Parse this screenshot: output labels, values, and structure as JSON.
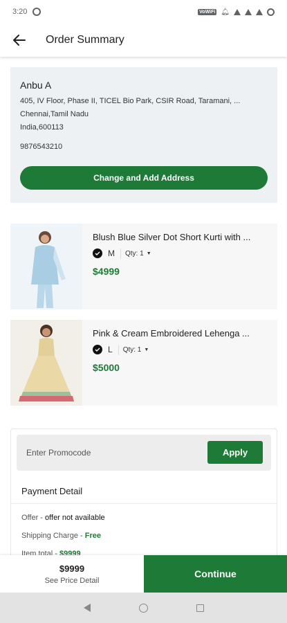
{
  "status_bar": {
    "time": "3:20",
    "vowifi": "VoWiFi"
  },
  "header": {
    "title": "Order Summary"
  },
  "address": {
    "name": "Anbu A",
    "line1": "405, IV Floor, Phase II, TICEL Bio Park, CSIR Road, Taramani, ...",
    "line2": "Chennai,Tamil Nadu",
    "line3": "India,600113",
    "phone": "9876543210",
    "button_label": "Change and Add Address"
  },
  "products": [
    {
      "title": "Blush Blue Silver Dot Short Kurti with ...",
      "size": "M",
      "qty_label": "Qty: 1",
      "price": "$4999",
      "image_icon": "product-photo-blue-kurti"
    },
    {
      "title": "Pink & Cream Embroidered Lehenga ...",
      "size": "L",
      "qty_label": "Qty: 1",
      "price": "$5000",
      "image_icon": "product-photo-cream-lehenga"
    }
  ],
  "promo": {
    "placeholder": "Enter Promocode",
    "apply_label": "Apply"
  },
  "payment": {
    "title": "Payment Detail",
    "offer_label": "Offer - ",
    "offer_value": "offer not available",
    "shipping_label": "Shipping Charge - ",
    "shipping_value": "Free",
    "item_total_label": "Item total - ",
    "item_total_value": "$9999"
  },
  "footer": {
    "total": "$9999",
    "see_detail": "See Price Detail",
    "continue_label": "Continue"
  },
  "colors": {
    "accent": "#1e7a37",
    "card_bg": "#eef1f4"
  }
}
